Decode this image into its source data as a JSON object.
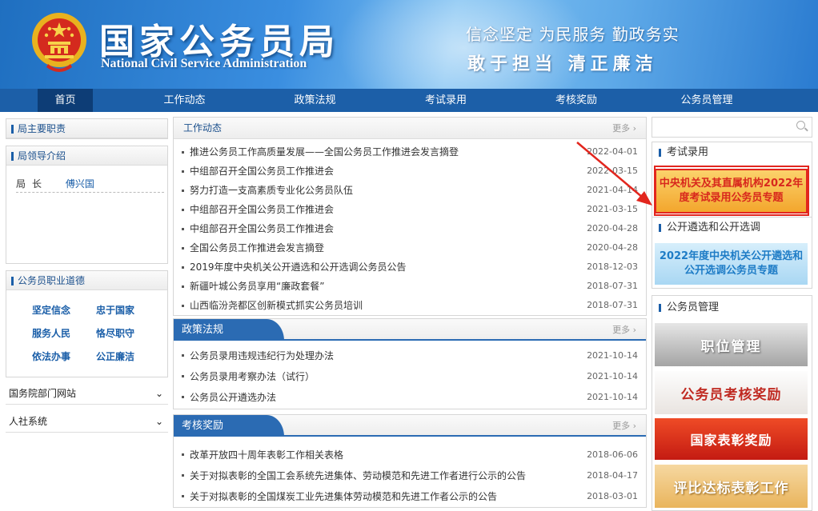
{
  "header": {
    "site_name_cn": "国家公务员局",
    "site_name_en": "National Civil Service Administration",
    "slogan_line1": "信念坚定  为民服务  勤政务实",
    "slogan_line2": "敢于担当  清正廉洁",
    "colors": {
      "brand_blue": "#1c5fa8",
      "accent_red": "#e2261e"
    }
  },
  "nav": {
    "items": [
      {
        "label": "首页"
      },
      {
        "label": "工作动态"
      },
      {
        "label": "政策法规"
      },
      {
        "label": "考试录用"
      },
      {
        "label": "考核奖励"
      },
      {
        "label": "公务员管理"
      }
    ]
  },
  "left": {
    "leaders_title": "局主要职责",
    "intro_title": "局领导介绍",
    "leader": {
      "role": "局长",
      "name": "傅兴国"
    },
    "ethics_title": "公务员职业道德",
    "ethics": [
      "坚定信念",
      "忠于国家",
      "服务人民",
      "恪尽职守",
      "依法办事",
      "公正廉洁"
    ],
    "links": [
      "国务院部门网站",
      "人社系统"
    ]
  },
  "middle": {
    "more_label": "更多",
    "work": {
      "title": "工作动态",
      "items": [
        {
          "title": "推进公务员工作高质量发展——全国公务员工作推进会发言摘登",
          "date": "2022-04-01"
        },
        {
          "title": "中组部召开全国公务员工作推进会",
          "date": "2022-03-15"
        },
        {
          "title": "努力打造一支高素质专业化公务员队伍",
          "date": "2021-04-14"
        },
        {
          "title": "中组部召开全国公务员工作推进会",
          "date": "2021-03-15"
        },
        {
          "title": "中组部召开全国公务员工作推进会",
          "date": "2020-04-28"
        },
        {
          "title": "全国公务员工作推进会发言摘登",
          "date": "2020-04-28"
        },
        {
          "title": "2019年度中央机关公开遴选和公开选调公务员公告",
          "date": "2018-12-03"
        },
        {
          "title": "新疆叶城公务员享用“廉政套餐”",
          "date": "2018-07-31"
        },
        {
          "title": "山西临汾尧都区创新模式抓实公务员培训",
          "date": "2018-07-31"
        }
      ]
    },
    "policy": {
      "title": "政策法规",
      "items": [
        {
          "title": "公务员录用违规违纪行为处理办法",
          "date": "2021-10-14"
        },
        {
          "title": "公务员录用考察办法（试行）",
          "date": "2021-10-14"
        },
        {
          "title": "公务员公开遴选办法",
          "date": "2021-10-14"
        }
      ]
    },
    "awards": {
      "title": "考核奖励",
      "items": [
        {
          "title": "改革开放四十周年表彰工作相关表格",
          "date": "2018-06-06"
        },
        {
          "title": "关于对拟表彰的全国工会系统先进集体、劳动模范和先进工作者进行公示的公告",
          "date": "2018-04-17"
        },
        {
          "title": "关于对拟表彰的全国煤炭工业先进集体劳动模范和先进工作者公示的公告",
          "date": "2018-03-01"
        }
      ]
    }
  },
  "right": {
    "exam_title": "考试录用",
    "exam_banner": "中央机关及其直属机构2022年度考试录用公务员专题",
    "select_title": "公开遴选和公开选调",
    "select_banner": "2022年度中央机关公开遴选和公开选调公务员专题",
    "mgmt_title": "公务员管理",
    "mgmt_banners": [
      "职位管理",
      "公务员考核奖励",
      "国家表彰奖励",
      "评比达标表彰工作"
    ]
  }
}
